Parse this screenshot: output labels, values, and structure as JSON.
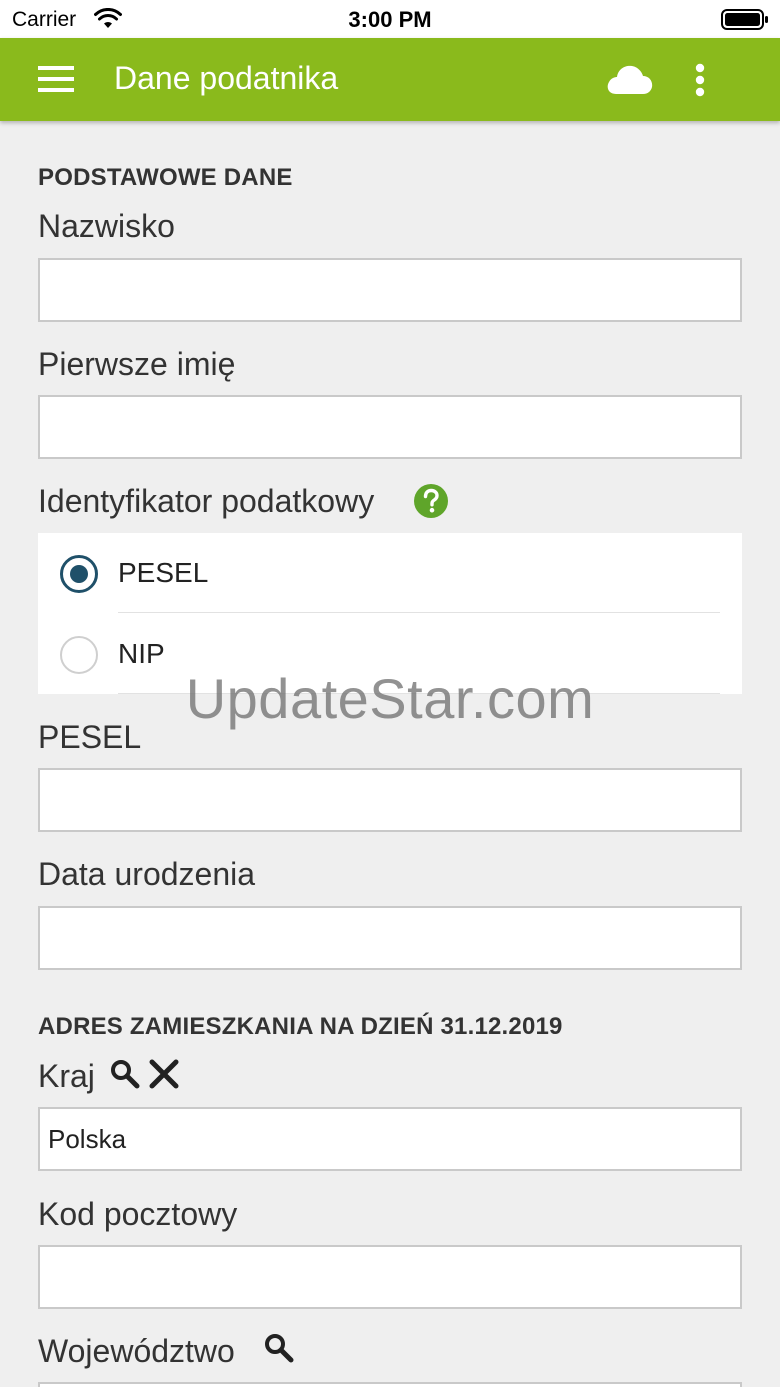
{
  "status_bar": {
    "carrier": "Carrier",
    "time": "3:00 PM"
  },
  "app_bar": {
    "title": "Dane podatnika",
    "icons": [
      "menu-icon",
      "cloud-icon",
      "more-vertical-icon"
    ],
    "color": "#8aba1c"
  },
  "sections": {
    "basic": {
      "title": "PODSTAWOWE DANE",
      "surname_label": "Nazwisko",
      "surname_value": "",
      "first_name_label": "Pierwsze imię",
      "first_name_value": "",
      "tax_id_label": "Identyfikator podatkowy",
      "tax_id_options": [
        {
          "label": "PESEL",
          "selected": true
        },
        {
          "label": "NIP",
          "selected": false
        }
      ],
      "pesel_label": "PESEL",
      "pesel_value": "",
      "birth_date_label": "Data urodzenia",
      "birth_date_value": ""
    },
    "address": {
      "title": "ADRES ZAMIESZKANIA NA DZIEŃ 31.12.2019",
      "country_label": "Kraj",
      "country_value": "Polska",
      "postal_code_label": "Kod pocztowy",
      "postal_code_value": "",
      "voivodeship_label": "Województwo",
      "voivodeship_value": ""
    }
  },
  "watermark": "UpdateStar.com",
  "colors": {
    "accent": "#8aba1c",
    "radio_selected": "#1f5069",
    "help_icon": "#5fa52a"
  }
}
